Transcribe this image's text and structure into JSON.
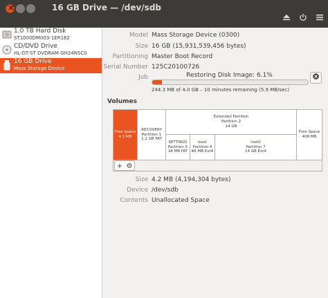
{
  "window": {
    "title": "16 GB Drive — /dev/sdb"
  },
  "header_buttons": {
    "eject_icon": "eject-icon",
    "power_icon": "power-icon",
    "menu_icon": "menu-icon"
  },
  "sidebar": {
    "devices": [
      {
        "name": "1.0 TB Hard Disk",
        "sub": "ST1000DM003-1ER162",
        "icon": "hard-disk-icon"
      },
      {
        "name": "CD/DVD Drive",
        "sub": "HL-DT-ST DVDRAM GH24NSC0",
        "icon": "optical-drive-icon"
      },
      {
        "name": "16 GB Drive",
        "sub": "Mass Storage Device",
        "icon": "usb-drive-icon"
      }
    ]
  },
  "drive": {
    "model_label": "Model",
    "model": "Mass Storage Device (0300)",
    "size_label": "Size",
    "size": "16 GB (15,931,539,456 bytes)",
    "partitioning_label": "Partitioning",
    "partitioning": "Master Boot Record",
    "serial_label": "Serial Number",
    "serial": "125C20100726",
    "job_label": "Job"
  },
  "job": {
    "title": "Restoring Disk Image: 6.1%",
    "progress": 0.061,
    "detail": "244.3 MB of 4.0 GB – 10 minutes remaining (5.9 MB/sec)"
  },
  "volumes": {
    "heading": "Volumes",
    "segments": {
      "free_start": {
        "line1": "Free Space",
        "line2": "4.2 MB"
      },
      "recovery": {
        "line1": "RECOVERY",
        "line2": "Partition 1",
        "line3": "1.2 GB FAT"
      },
      "extended": {
        "line1": "Extended Partition",
        "line2": "Partition 2",
        "line3": "14 GB"
      },
      "settings": {
        "line1": "SETTINGS",
        "line2": "Partition 5",
        "line3": "34 MB FAT"
      },
      "boot": {
        "line1": "boot",
        "line2": "Partition 6",
        "line3": "66 MB Ext4"
      },
      "root": {
        "line1": "root0",
        "line2": "Partition 7",
        "line3": "14 GB Ext4"
      },
      "free_end": {
        "line1": "Free Space",
        "line2": "408 MB"
      }
    },
    "toolbar": {
      "add": "+",
      "more": "⚙"
    }
  },
  "selected_volume": {
    "size_label": "Size",
    "size": "4.2 MB (4,194,304 bytes)",
    "device_label": "Device",
    "device": "/dev/sdb",
    "contents_label": "Contents",
    "contents": "Unallocated Space"
  },
  "colors": {
    "accent": "#e95420",
    "titlebar": "#3c3b37"
  }
}
